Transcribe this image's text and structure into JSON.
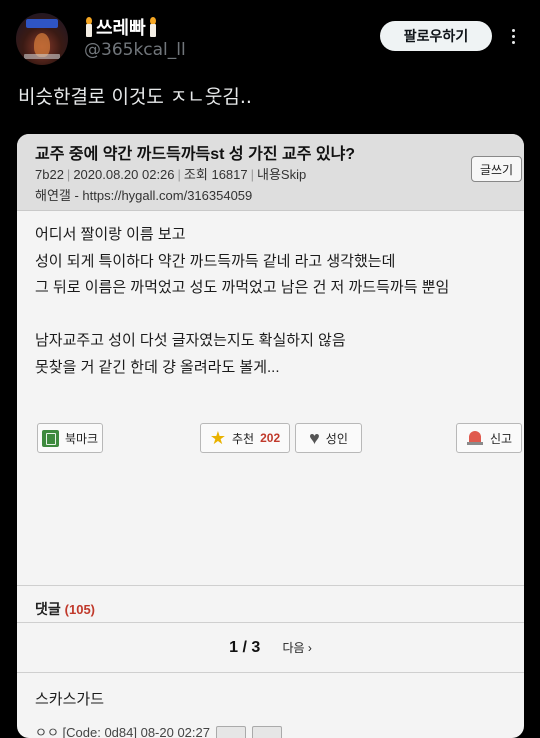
{
  "tweet": {
    "display_name": "쓰레빠",
    "handle": "@365kcal_ll",
    "follow_label": "팔로우하기",
    "text": "비슷한결로 이것도 ㅈㄴ웃김.."
  },
  "post": {
    "title": "교주 중에 약간 까드득까득st 성 가진 교주 있냐?",
    "meta": {
      "board": "7b22",
      "date": "2020.08.20 02:26",
      "views_label": "조회",
      "views": "16817",
      "content_label": "내용Skip"
    },
    "source": "해연갤 - https://hygall.com/316354059",
    "write_label": "글쓰기",
    "body": [
      "어디서 짤이랑 이름 보고",
      "성이 되게 특이하다 약간 까드득까득 같네 라고 생각했는데",
      "그 뒤로 이름은 까먹었고 성도 까먹었고 남은 건 저 까드득까득 뿐임",
      "",
      "남자교주고 성이 다섯 글자였는지도 확실하지 않음",
      "못찾을 거 같긴 한데 걍 올려라도 볼게..."
    ],
    "buttons": {
      "bookmark": "북마크",
      "recommend": "추천",
      "recommend_count": "202",
      "adult": "성인",
      "report": "신고"
    }
  },
  "comments": {
    "label": "댓글",
    "count": "(105)",
    "pager": {
      "current": "1 / 3",
      "next": "다음 ›"
    },
    "first": {
      "name": "스카스가드",
      "meta": "ㅇㅇ [Code: 0d84]   08-20 02:27"
    }
  },
  "icons": [
    "candle-icon",
    "more-icon",
    "bookmark-icon",
    "star-icon",
    "heart-icon",
    "siren-icon"
  ]
}
